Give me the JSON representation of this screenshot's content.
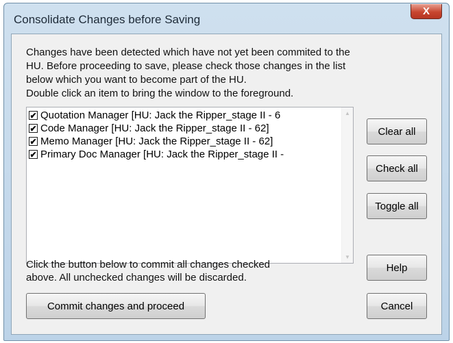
{
  "window": {
    "title": "Consolidate Changes before Saving",
    "close_label": "X"
  },
  "intro": {
    "line1": "Changes have been detected which have not yet been commited to the",
    "line2": "HU.  Before proceeding to save, please check those changes in the list",
    "line3": "below which you want to become part of the HU.",
    "line4": "Double click an item to bring the window to the foreground."
  },
  "list": {
    "items": [
      {
        "label": "Quotation Manager [HU: Jack the Ripper_stage II - 6",
        "checked": true
      },
      {
        "label": "Code Manager [HU: Jack the Ripper_stage II - 62]",
        "checked": true
      },
      {
        "label": "Memo Manager [HU: Jack the Ripper_stage II - 62]",
        "checked": true
      },
      {
        "label": "Primary Doc Manager [HU: Jack the Ripper_stage II -",
        "checked": true
      }
    ],
    "check_glyph": "✔"
  },
  "buttons": {
    "clear_all": "Clear all",
    "check_all": "Check all",
    "toggle_all": "Toggle all",
    "help": "Help",
    "cancel": "Cancel",
    "commit": "Commit changes and proceed"
  },
  "footer": {
    "line1": "Click the button below to commit all changes checked",
    "line2": "above. All unchecked changes will be discarded."
  },
  "colors": {
    "frame": "#bcd3e8",
    "close_button": "#c8462f",
    "dialog_body": "#f0f0f0"
  }
}
